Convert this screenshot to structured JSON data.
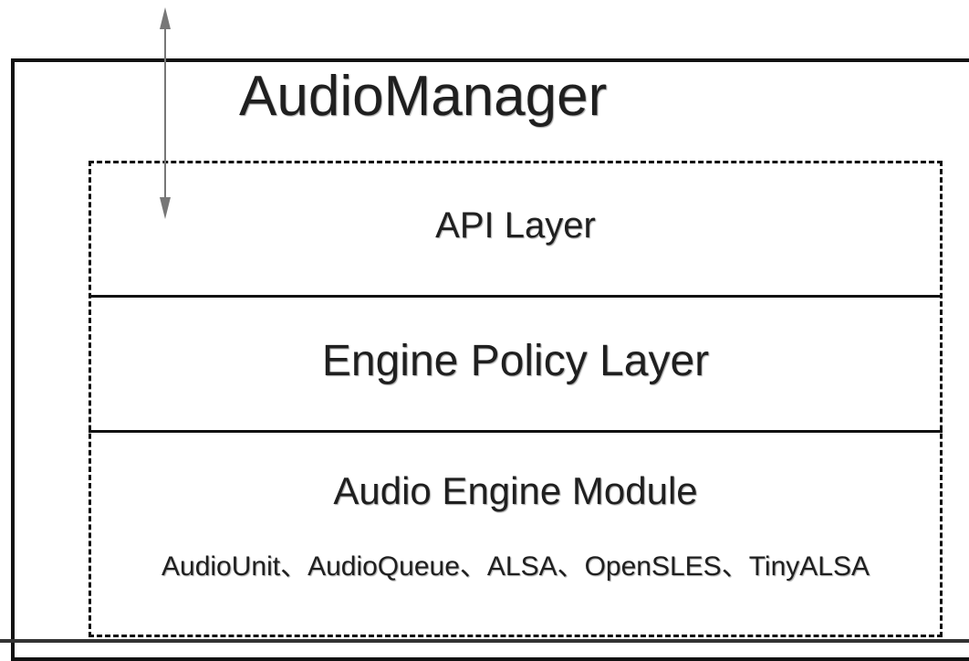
{
  "diagram": {
    "title": "AudioManager",
    "layers": [
      {
        "label": "API Layer"
      },
      {
        "label": "Engine Policy Layer"
      },
      {
        "label": "Audio Engine Module",
        "detail": "AudioUnit、AudioQueue、ALSA、OpenSLES、TinyALSA"
      }
    ],
    "colors": {
      "line": "#111111",
      "arrow": "#777777",
      "text": "#1f1f1f"
    },
    "icons": [
      "double-headed-arrow-icon"
    ]
  }
}
